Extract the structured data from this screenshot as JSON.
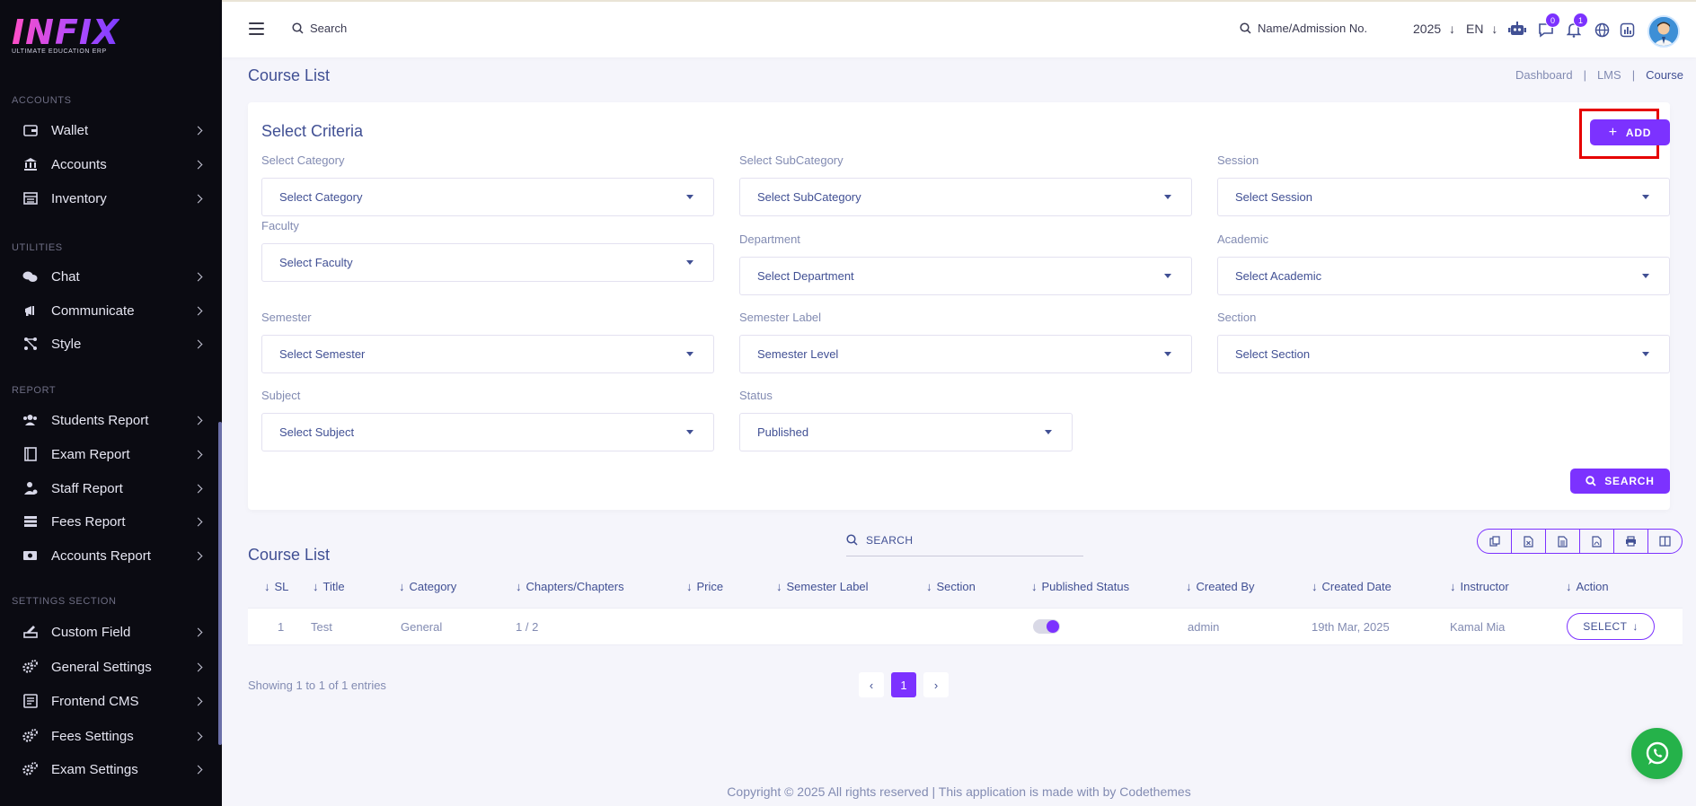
{
  "brand": {
    "name": "INFIX",
    "tagline": "ULTIMATE EDUCATION ERP"
  },
  "sidebar": {
    "sections": [
      {
        "label": "ACCOUNTS",
        "items": [
          {
            "label": "Wallet",
            "icon": "wallet-icon"
          },
          {
            "label": "Accounts",
            "icon": "bank-icon"
          },
          {
            "label": "Inventory",
            "icon": "inventory-icon"
          }
        ]
      },
      {
        "label": "UTILITIES",
        "items": [
          {
            "label": "Chat",
            "icon": "chat-icon"
          },
          {
            "label": "Communicate",
            "icon": "megaphone-icon"
          },
          {
            "label": "Style",
            "icon": "style-icon"
          }
        ]
      },
      {
        "label": "REPORT",
        "items": [
          {
            "label": "Students Report",
            "icon": "users-icon"
          },
          {
            "label": "Exam Report",
            "icon": "book-icon"
          },
          {
            "label": "Staff Report",
            "icon": "staff-icon"
          },
          {
            "label": "Fees Report",
            "icon": "fees-icon"
          },
          {
            "label": "Accounts Report",
            "icon": "money-icon"
          }
        ]
      },
      {
        "label": "SETTINGS SECTION",
        "items": [
          {
            "label": "Custom Field",
            "icon": "custom-field-icon"
          },
          {
            "label": "General Settings",
            "icon": "gears-icon"
          },
          {
            "label": "Frontend CMS",
            "icon": "cms-icon"
          },
          {
            "label": "Fees Settings",
            "icon": "gears-icon"
          },
          {
            "label": "Exam Settings",
            "icon": "gears-icon"
          }
        ]
      }
    ]
  },
  "header": {
    "search_label": "Search",
    "name_search_label": "Name/Admission No.",
    "year": "2025",
    "language": "EN",
    "chat_count": "0",
    "notification_count": "1"
  },
  "page": {
    "title": "Course List",
    "breadcrumb": [
      "Dashboard",
      "LMS",
      "Course"
    ]
  },
  "criteria": {
    "title": "Select Criteria",
    "add_label": "ADD",
    "search_label": "SEARCH",
    "fields": {
      "category": {
        "label": "Select Category",
        "value": "Select Category"
      },
      "subcategory": {
        "label": "Select SubCategory",
        "value": "Select SubCategory"
      },
      "session": {
        "label": "Session",
        "value": "Select Session"
      },
      "faculty": {
        "label": "Faculty",
        "value": "Select Faculty"
      },
      "department": {
        "label": "Department",
        "value": "Select Department"
      },
      "academic": {
        "label": "Academic",
        "value": "Select Academic"
      },
      "semester": {
        "label": "Semester",
        "value": "Select Semester"
      },
      "semester_label": {
        "label": "Semester Label",
        "value": "Semester Level"
      },
      "section": {
        "label": "Section",
        "value": "Select Section"
      },
      "subject": {
        "label": "Subject",
        "value": "Select Subject"
      },
      "status": {
        "label": "Status",
        "value": "Published"
      }
    }
  },
  "course_list": {
    "title": "Course List",
    "search_placeholder": "SEARCH",
    "export_buttons": [
      "copy-icon",
      "excel-icon",
      "csv-icon",
      "pdf-icon",
      "print-icon",
      "columns-icon"
    ],
    "columns": [
      "SL",
      "Title",
      "Category",
      "Chapters/Chapters",
      "Price",
      "Semester Label",
      "Section",
      "Published Status",
      "Created By",
      "Created Date",
      "Instructor",
      "Action"
    ],
    "rows": [
      {
        "sl": "1",
        "title": "Test",
        "category": "General",
        "chapters": "1 / 2",
        "price": "",
        "semester_label": "",
        "section": "",
        "published": true,
        "created_by": "admin",
        "created_date": "19th Mar, 2025",
        "instructor": "Kamal Mia",
        "action": "SELECT"
      }
    ],
    "showing_text": "Showing 1 to 1 of 1 entries",
    "current_page": "1"
  },
  "footer": {
    "text": "Copyright © 2025 All rights reserved | This application is made with by Codethemes"
  },
  "colors": {
    "accent": "#7c32ff",
    "text": "#415094",
    "muted": "#828bb2",
    "sidebar_bg": "#0b0b12",
    "highlight": "#e60000",
    "whatsapp": "#25b24a"
  }
}
